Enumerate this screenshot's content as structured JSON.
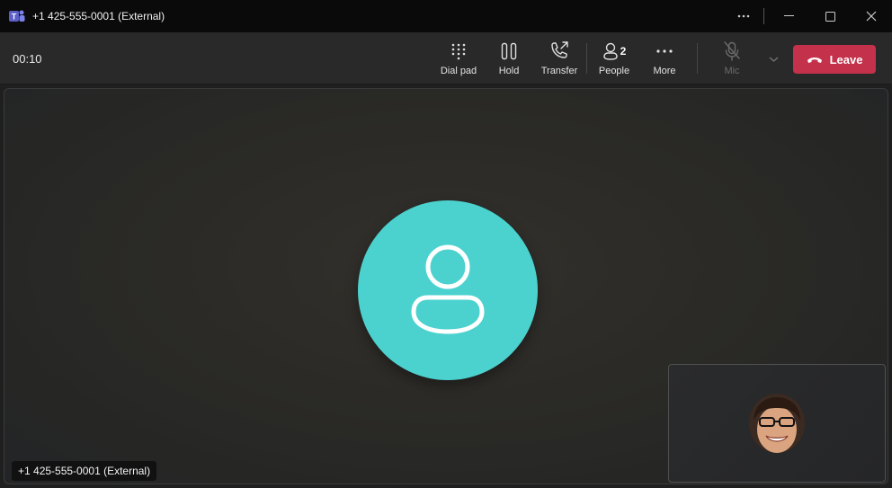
{
  "window": {
    "title": "+1 425-555-0001 (External)"
  },
  "toolbar": {
    "timer": "00:10",
    "dial_pad": "Dial pad",
    "hold": "Hold",
    "transfer": "Transfer",
    "people": "People",
    "people_count": "2",
    "more": "More",
    "mic": "Mic",
    "leave": "Leave"
  },
  "stage": {
    "participant_name": "+1 425-555-0001 (External)",
    "avatar_color": "#4bd2cf"
  },
  "colors": {
    "leave_button": "#c4314b",
    "toolbar_bg": "#292929",
    "titlebar_bg": "#0a0a0a"
  }
}
